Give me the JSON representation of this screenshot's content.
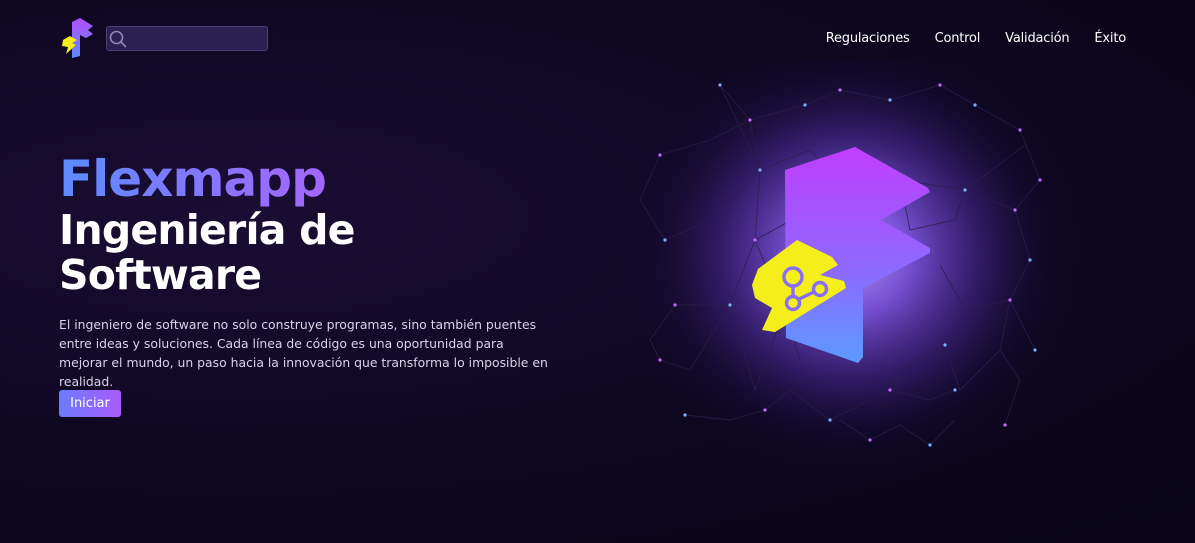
{
  "header": {
    "logo_icon": "flexmapp-logo-icon",
    "search": {
      "icon": "search-icon",
      "placeholder": ""
    },
    "nav": [
      {
        "label": "Regulaciones"
      },
      {
        "label": "Control"
      },
      {
        "label": "Validación"
      },
      {
        "label": "Éxito"
      }
    ]
  },
  "hero": {
    "brand": "Flexmapp",
    "headline": "Ingeniería de Software",
    "description": "El ingeniero de software no solo construye programas, sino también puentes entre ideas y soluciones. Cada línea de código es una oportunidad para mejorar el mundo, un paso hacia la innovación que transforma lo imposible en realidad.",
    "cta_label": "Iniciar"
  },
  "illustration": {
    "icon": "flexmapp-network-illustration-icon"
  },
  "colors": {
    "background": "#0d0720",
    "accent_purple": "#a855f7",
    "accent_blue": "#6a7cff",
    "accent_yellow": "#f4ee1a"
  }
}
